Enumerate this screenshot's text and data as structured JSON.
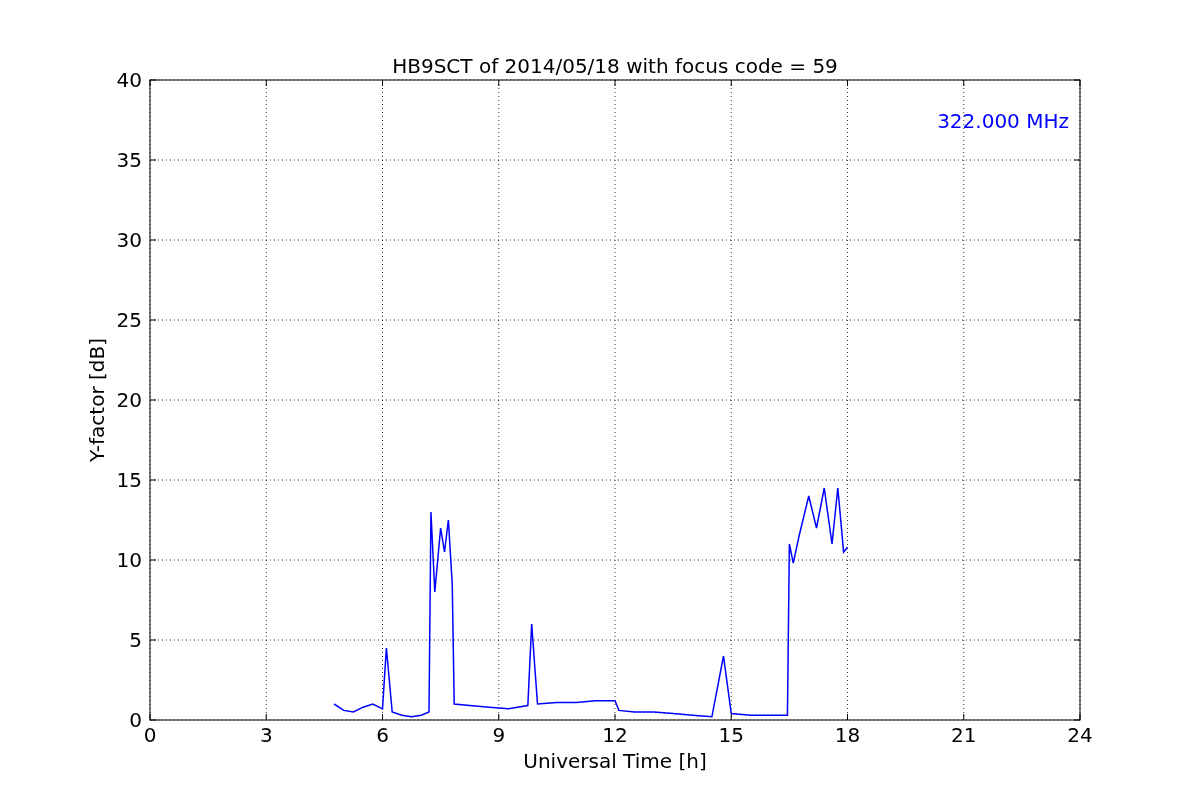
{
  "chart_data": {
    "type": "line",
    "title": "HB9SCT of 2014/05/18 with focus code = 59",
    "xlabel": "Universal Time [h]",
    "ylabel": "Y-factor [dB]",
    "x": [
      4.75,
      5.0,
      5.25,
      5.5,
      5.75,
      6.0,
      6.1,
      6.25,
      6.5,
      6.75,
      7.0,
      7.2,
      7.25,
      7.35,
      7.5,
      7.6,
      7.7,
      7.8,
      7.85,
      8.25,
      8.75,
      9.25,
      9.75,
      9.85,
      10.0,
      10.5,
      11.0,
      11.5,
      12.0,
      12.1,
      12.5,
      13.0,
      13.5,
      14.0,
      14.5,
      14.8,
      15.0,
      15.5,
      16.0,
      16.45,
      16.5,
      16.6,
      16.75,
      17.0,
      17.2,
      17.4,
      17.6,
      17.75,
      17.9,
      18.0
    ],
    "grid": true,
    "series": [
      {
        "color": "#0000ff",
        "values": [
          1.0,
          0.6,
          0.5,
          0.8,
          1.0,
          0.7,
          4.5,
          0.5,
          0.3,
          0.2,
          0.3,
          0.5,
          13.0,
          8.0,
          12.0,
          10.5,
          12.5,
          8.5,
          1.0,
          0.9,
          0.8,
          0.7,
          0.9,
          6.0,
          1.0,
          1.1,
          1.1,
          1.2,
          1.2,
          0.6,
          0.5,
          0.5,
          0.4,
          0.3,
          0.2,
          4.0,
          0.4,
          0.3,
          0.3,
          0.3,
          11.0,
          9.8,
          11.5,
          14.0,
          12.0,
          14.5,
          11.0,
          14.5,
          10.5,
          10.8
        ]
      }
    ],
    "xlim": [
      0,
      24
    ],
    "ylim": [
      0,
      40
    ],
    "xticks": [
      0,
      3,
      6,
      9,
      12,
      15,
      18,
      21,
      24
    ],
    "yticks": [
      0,
      5,
      10,
      15,
      20,
      25,
      30,
      35,
      40
    ],
    "annotations": [
      {
        "text": "322.000 MHz"
      }
    ]
  }
}
